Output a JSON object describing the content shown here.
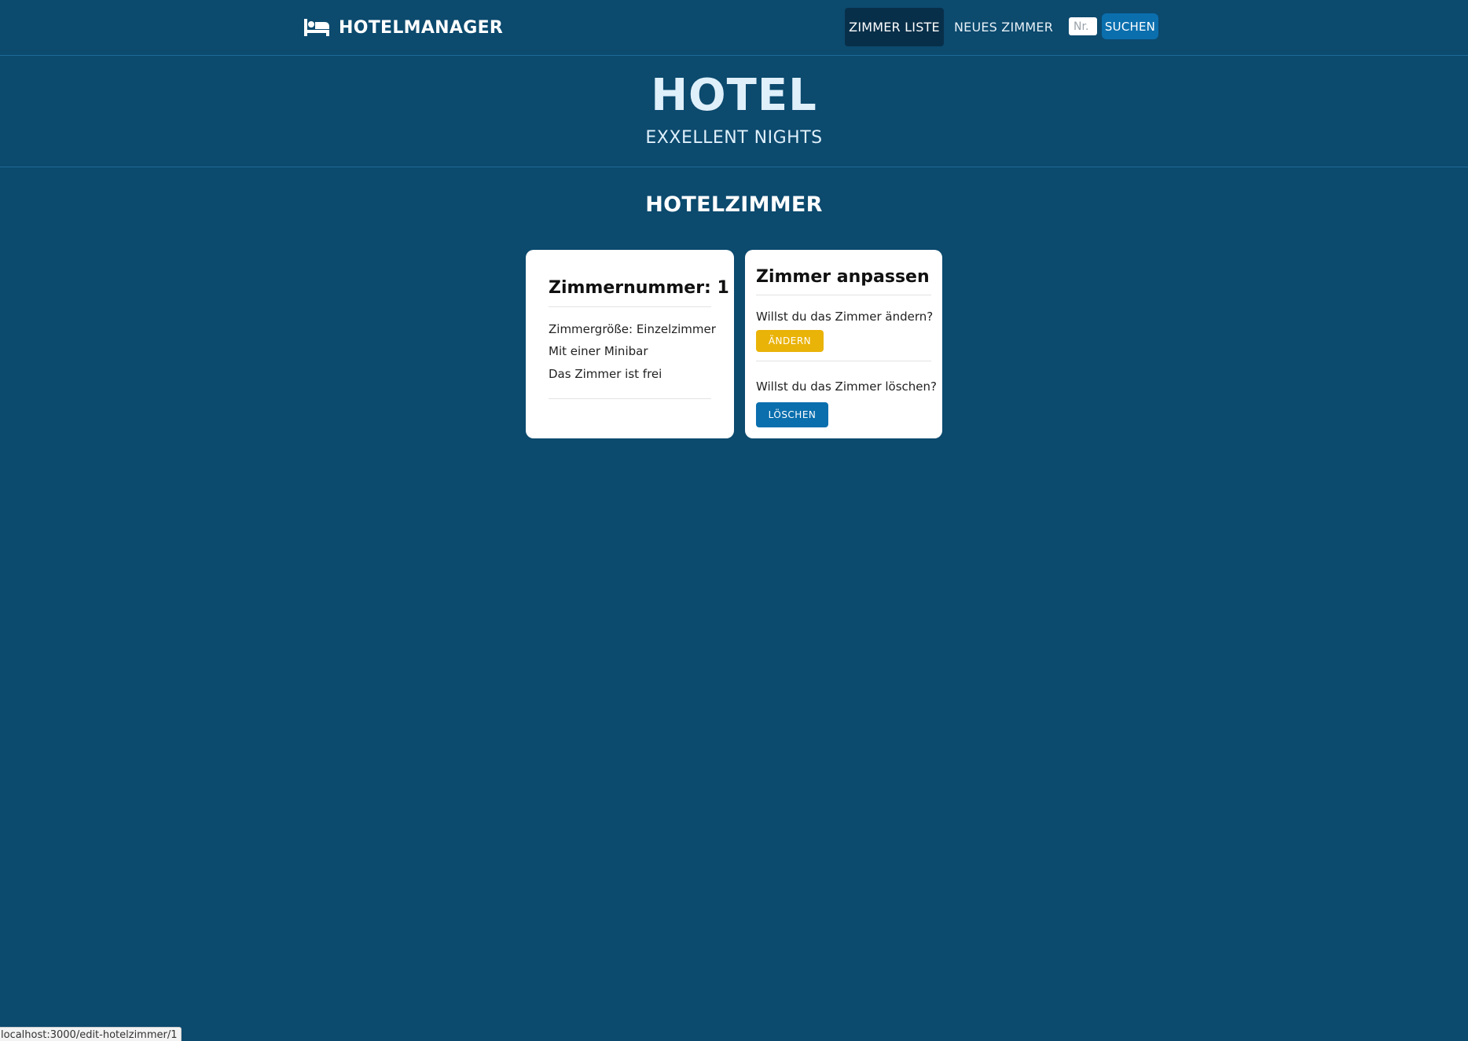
{
  "nav": {
    "brand": "HOTELMANAGER",
    "brand_icon": "bed-icon",
    "links": [
      {
        "label": "ZIMMER LISTE",
        "active": true
      },
      {
        "label": "NEUES ZIMMER",
        "active": false
      }
    ],
    "search": {
      "placeholder": "Nr.",
      "value": "",
      "button_label": "SUCHEN"
    }
  },
  "hero": {
    "title": "HOTEL",
    "subtitle": "EXXELLENT NIGHTS"
  },
  "section": {
    "title": "HOTELZIMMER"
  },
  "room_card": {
    "title": "Zimmernummer: 1",
    "lines": [
      "Zimmergröße: Einzelzimmer",
      "Mit einer Minibar",
      "Das Zimmer ist frei"
    ]
  },
  "edit_card": {
    "title": "Zimmer anpassen",
    "change_question": "Willst du das Zimmer ändern?",
    "change_button": "ÄNDERN",
    "delete_question": "Willst du das Zimmer löschen?",
    "delete_button": "LÖSCHEN"
  },
  "status_bar": {
    "url": "localhost:3000/edit-hotelzimmer/1"
  },
  "colors": {
    "background": "#0c4a6e",
    "nav_active": "#082f49",
    "primary_button": "#0b6fae",
    "warning_button": "#eab308",
    "card": "#ffffff"
  }
}
